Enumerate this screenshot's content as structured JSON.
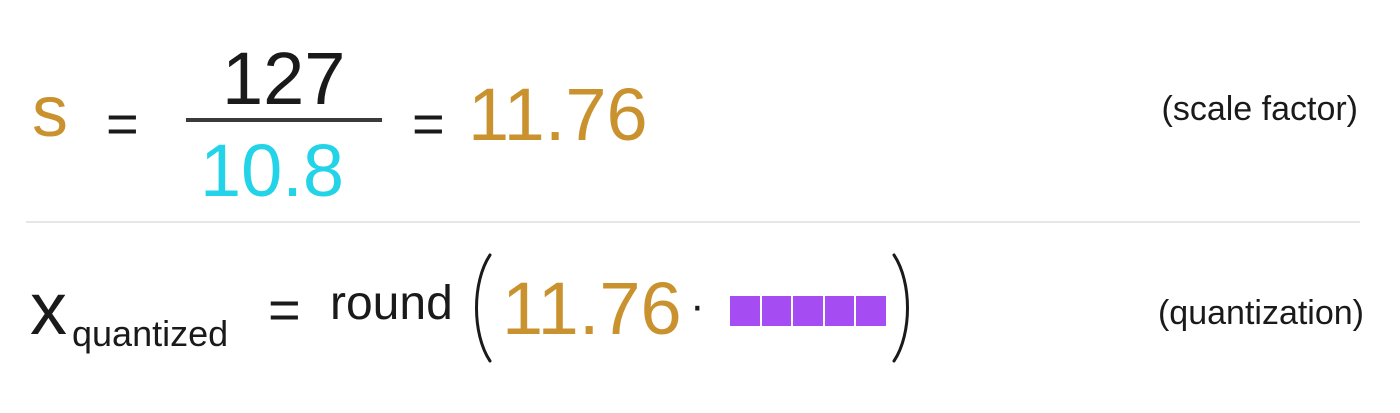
{
  "colors": {
    "scale": "#c9922e",
    "denominator": "#23d3e8",
    "text": "#1a1a1a",
    "masked": "#a54cf2",
    "divider": "#e6e6e6"
  },
  "scale_row": {
    "variable": "s",
    "equals": "=",
    "numerator": "127",
    "denominator": "10.8",
    "equals_result": "=",
    "result": "11.76",
    "note": "(scale factor)"
  },
  "quant_row": {
    "variable": "x",
    "subscript": "quantized",
    "equals": "=",
    "function": "round",
    "scale": "11.76",
    "operator": "·",
    "masked_segments": 5,
    "note": "(quantization)"
  }
}
